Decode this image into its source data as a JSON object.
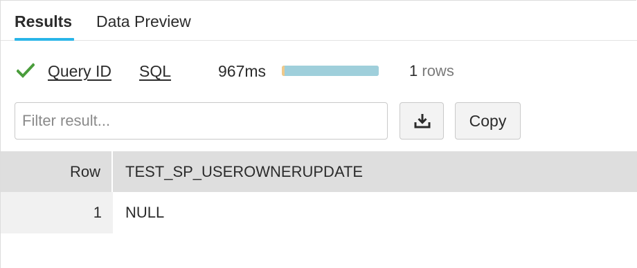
{
  "tabs": [
    {
      "label": "Results",
      "active": true
    },
    {
      "label": "Data Preview",
      "active": false
    }
  ],
  "status": {
    "icon": "check-icon",
    "success_color": "#4a9d3c",
    "query_id_label": "Query ID",
    "sql_label": "SQL",
    "duration": "967ms",
    "rows_count": "1",
    "rows_label": "rows"
  },
  "toolbar": {
    "filter_placeholder": "Filter result...",
    "filter_value": "",
    "download_icon": "download-icon",
    "copy_label": "Copy"
  },
  "table": {
    "columns": [
      "Row",
      "TEST_SP_USEROWNERUPDATE"
    ],
    "rows": [
      {
        "row": "1",
        "value": "NULL"
      }
    ]
  },
  "colors": {
    "accent": "#29b5e8",
    "progress_exec": "#9fcfdb",
    "progress_compile": "#f0c98a"
  }
}
